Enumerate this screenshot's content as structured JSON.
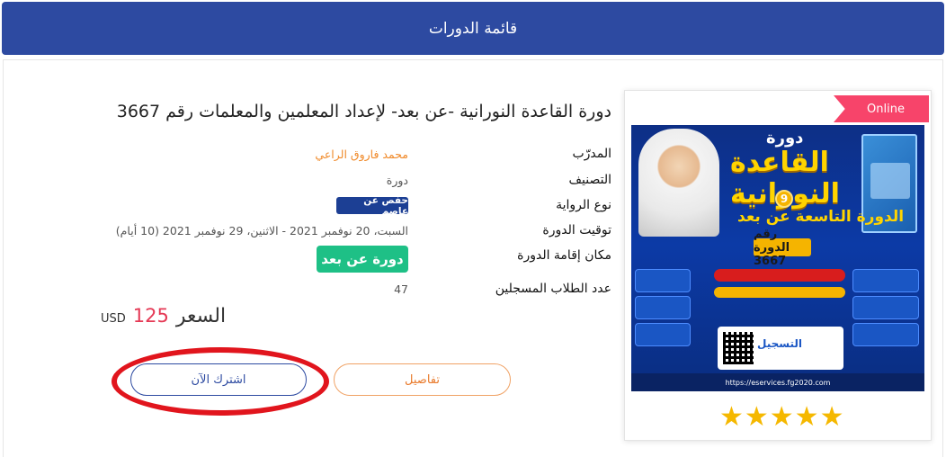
{
  "header": {
    "title": "قائمة الدورات"
  },
  "course": {
    "title": "دورة القاعدة النورانية -عن بعد- لإعداد المعلمين والمعلمات رقم 3667",
    "badge": "Online",
    "rating_stars": "★★★★★",
    "rating_value": 5,
    "fields": {
      "trainer_label": "المدرّب",
      "trainer_value": "محمد فاروق الراعي",
      "category_label": "التصنيف",
      "category_value": "دورة",
      "narration_label": "نوع الرواية",
      "narration_value": "حفص عن عاصم",
      "timing_label": "توقيت الدورة",
      "timing_value": "السبت، 20 نوفمبر 2021 - الاثنين، 29 نوفمبر 2021 (10 أيام)",
      "venue_label": "مكان إقامة الدورة",
      "venue_value": "دورة عن بعد",
      "students_label": "عدد الطلاب المسجلين",
      "students_value": "47"
    },
    "price": {
      "label": "السعر",
      "amount": "125",
      "currency": "USD"
    },
    "buttons": {
      "details": "تفاصيل",
      "subscribe": "اشترك الآن"
    },
    "poster": {
      "line1": "دورة",
      "line2": "القاعدة النورانية",
      "circle": "9",
      "line3": "الدورة التاسعة عن بعد",
      "number": "رقم الدورة 3667",
      "register": "التسجيل",
      "footer": "https://eservices.fg2020.com"
    }
  },
  "colors": {
    "header_bg": "#2d4aa1",
    "online_badge": "#f7446a",
    "trainer_text": "#f08a2a",
    "venue_badge": "#1ec086",
    "price_amount": "#e53955",
    "annotation_ring": "#e1151d"
  }
}
